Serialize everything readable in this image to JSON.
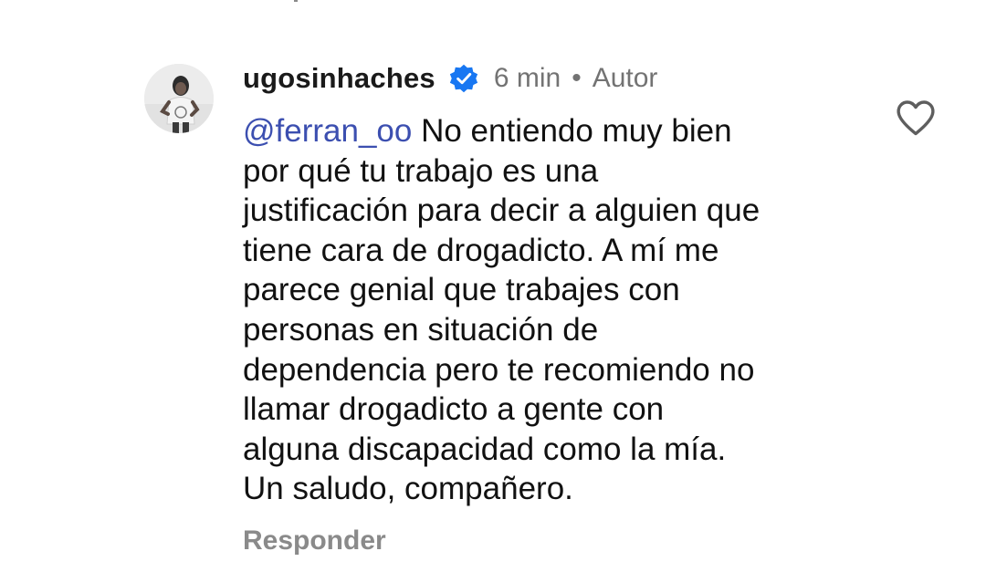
{
  "comment": {
    "username": "ugosinhaches",
    "verified_icon": "verified-badge-icon",
    "time": "6 min",
    "separator": "•",
    "author_label": "Autor",
    "mention": "@ferran_oo",
    "lines": [
      " No entiendo muy bien",
      "por qué tu trabajo es una",
      "justificación para decir a alguien que",
      "tiene cara de drogadicto. A mí me",
      "parece genial que trabajes con",
      "personas en situación de",
      "dependencia pero te recomiendo no",
      "llamar drogadicto a gente con",
      "alguna discapacidad como la mía.",
      "Un saludo, compañero."
    ],
    "reply_label": "Responder",
    "like_icon": "heart-outline-icon"
  },
  "colors": {
    "mention": "#3c4fb0",
    "verified": "#1877f2",
    "muted": "#737373",
    "text": "#111111"
  }
}
